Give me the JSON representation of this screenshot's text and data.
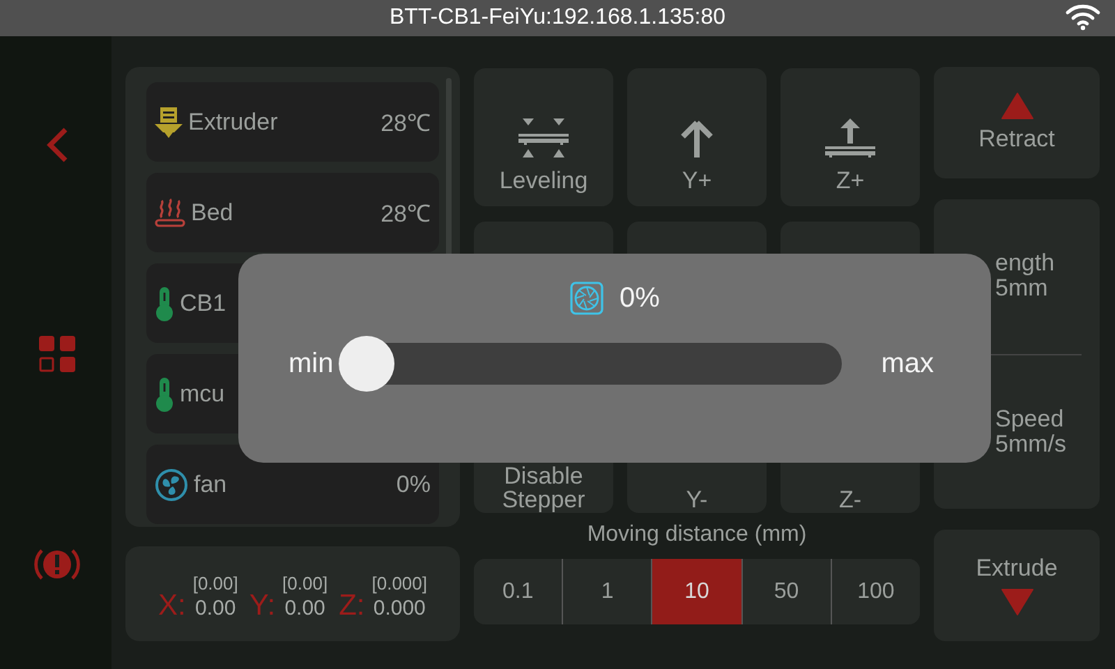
{
  "status_bar": {
    "title": "BTT-CB1-FeiYu:192.168.1.135:80"
  },
  "sensors": [
    {
      "kind": "extruder",
      "name": "Extruder",
      "value": "28℃"
    },
    {
      "kind": "bed",
      "name": "Bed",
      "value": "28℃"
    },
    {
      "kind": "thermometer",
      "name": "CB1"
    },
    {
      "kind": "thermometer",
      "name": "mcu"
    },
    {
      "kind": "fan",
      "name": "fan",
      "value": "0%"
    }
  ],
  "position": [
    {
      "axis": "X:",
      "target": "[0.00]",
      "value": "0.00"
    },
    {
      "axis": "Y:",
      "target": "[0.00]",
      "value": "0.00"
    },
    {
      "axis": "Z:",
      "target": "[0.000]",
      "value": "0.000"
    }
  ],
  "move_buttons": [
    {
      "kind": "leveling",
      "label": "Leveling"
    },
    {
      "kind": "y_up",
      "label": "Y+"
    },
    {
      "kind": "z_up",
      "label": "Z+"
    },
    {
      "kind": "blank"
    },
    {
      "kind": "blank"
    },
    {
      "kind": "blank"
    },
    {
      "kind": "text",
      "label": "Disable Stepper"
    },
    {
      "kind": "text",
      "label": "Y-"
    },
    {
      "kind": "text",
      "label": "Z-"
    }
  ],
  "extruder": {
    "retract": "Retract",
    "length_label": "ength",
    "length": "5mm",
    "speed_label": "Speed",
    "speed": "5mm/s",
    "extrude": "Extrude"
  },
  "distance": {
    "title": "Moving distance (mm)",
    "options": [
      {
        "label": "0.1",
        "selected": false
      },
      {
        "label": "1",
        "selected": false
      },
      {
        "label": "10",
        "selected": true
      },
      {
        "label": "50",
        "selected": false
      },
      {
        "label": "100",
        "selected": false
      }
    ]
  },
  "fan_dialog": {
    "value": "0%",
    "min": "min",
    "max": "max",
    "level": 0
  }
}
